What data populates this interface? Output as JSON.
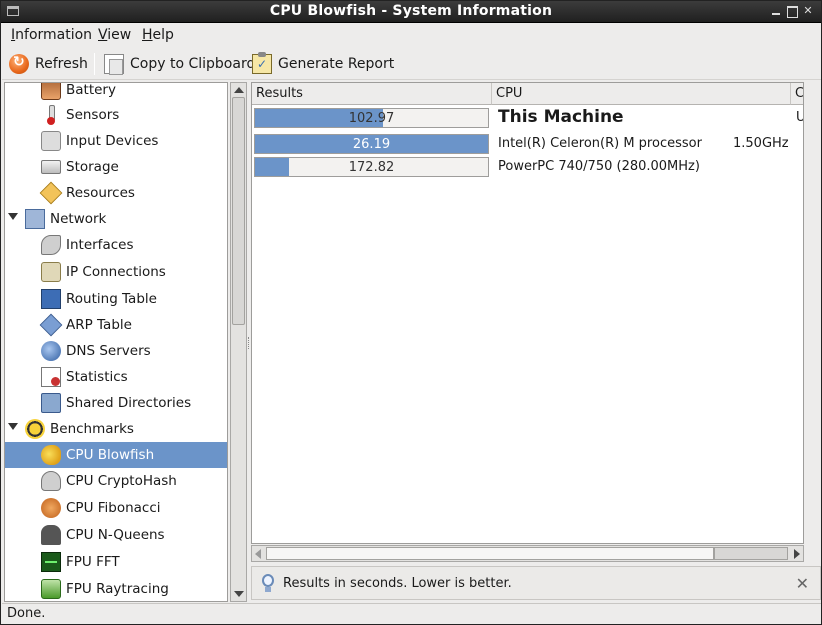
{
  "window": {
    "title": "CPU Blowfish - System Information"
  },
  "menubar": {
    "items": [
      {
        "pre": "",
        "mnemonic": "I",
        "rest": "nformation"
      },
      {
        "pre": "",
        "mnemonic": "V",
        "rest": "iew"
      },
      {
        "pre": "",
        "mnemonic": "H",
        "rest": "elp"
      }
    ]
  },
  "toolbar": {
    "refresh": "Refresh",
    "copy": "Copy to Clipboard",
    "report": "Generate Report"
  },
  "sidebar": {
    "items": [
      {
        "label": "Battery",
        "icon": "battery-icon"
      },
      {
        "label": "Sensors",
        "icon": "thermometer-icon"
      },
      {
        "label": "Input Devices",
        "icon": "keyboard-icon"
      },
      {
        "label": "Storage",
        "icon": "hard-drive-icon"
      },
      {
        "label": "Resources",
        "icon": "resources-icon"
      },
      {
        "label": "Network",
        "icon": "network-icon"
      },
      {
        "label": "Interfaces",
        "icon": "network-interface-icon"
      },
      {
        "label": "IP Connections",
        "icon": "plug-icon"
      },
      {
        "label": "Routing Table",
        "icon": "routing-icon"
      },
      {
        "label": "ARP Table",
        "icon": "arp-icon"
      },
      {
        "label": "DNS Servers",
        "icon": "globe-icon"
      },
      {
        "label": "Statistics",
        "icon": "statistics-icon"
      },
      {
        "label": "Shared Directories",
        "icon": "shared-folder-icon"
      },
      {
        "label": "Benchmarks",
        "icon": "benchmark-icon"
      },
      {
        "label": "CPU Blowfish",
        "icon": "blowfish-icon"
      },
      {
        "label": "CPU CryptoHash",
        "icon": "keys-icon"
      },
      {
        "label": "CPU Fibonacci",
        "icon": "shell-icon"
      },
      {
        "label": "CPU N-Queens",
        "icon": "chess-queen-icon"
      },
      {
        "label": "FPU FFT",
        "icon": "waveform-icon"
      },
      {
        "label": "FPU Raytracing",
        "icon": "raytracing-icon"
      }
    ]
  },
  "results": {
    "headers": {
      "results": "Results",
      "cpu": "CPU",
      "cut": "C"
    },
    "rows": [
      {
        "value": "102.97",
        "fill": 0.55,
        "cpu": "This Machine",
        "freq": "",
        "extra": "U"
      },
      {
        "value": "26.19",
        "fill": 1.0,
        "cpu": "Intel(R) Celeron(R) M processor",
        "freq": "1.50GHz",
        "extra": ""
      },
      {
        "value": "172.82",
        "fill": 0.145,
        "cpu": "PowerPC 740/750 (280.00MHz)",
        "freq": "",
        "extra": ""
      }
    ]
  },
  "infobar": {
    "text": "Results in seconds. Lower is better."
  },
  "statusbar": {
    "text": "Done."
  },
  "colors": {
    "selection": "#6b94c9",
    "titlebar": "#2a2a2a"
  }
}
